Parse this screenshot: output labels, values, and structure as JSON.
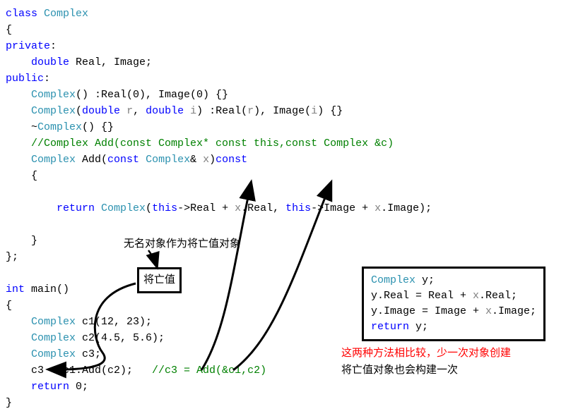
{
  "code": {
    "l1_kw": "class",
    "l1_type": " Complex",
    "l2": "{",
    "l3_kw": "private",
    "l3_colon": ":",
    "l4_kw": "double",
    "l4_rest": " Real, Image;",
    "l5_kw": "public",
    "l5_colon": ":",
    "l6_type": "Complex",
    "l6_rest": "() :Real(0), Image(0) {}",
    "l7_type": "Complex",
    "l7_a": "(",
    "l7_kw1": "double",
    "l7_b": " ",
    "l7_id1": "r",
    "l7_c": ", ",
    "l7_kw2": "double",
    "l7_d": " ",
    "l7_id2": "i",
    "l7_e": ") :Real(",
    "l7_id3": "r",
    "l7_f": "), Image(",
    "l7_id4": "i",
    "l7_g": ") {}",
    "l8_a": "~",
    "l8_type": "Complex",
    "l8_b": "() {}",
    "l9_comment": "//Complex Add(const Complex* const this,const Complex &c)",
    "l10_type": "Complex",
    "l10_a": " Add(",
    "l10_kw1": "const",
    "l10_b": " ",
    "l10_type2": "Complex",
    "l10_c": "& ",
    "l10_id": "x",
    "l10_d": ")",
    "l10_kw2": "const",
    "l11": "{",
    "l12_kw": "return",
    "l12_a": " ",
    "l12_type": "Complex",
    "l12_b": "(",
    "l12_id1": "this",
    "l12_c": "->Real + ",
    "l12_id2": "x",
    "l12_d": ".Real, ",
    "l12_id3": "this",
    "l12_e": "->Image + ",
    "l12_id4": "x",
    "l12_f": ".Image);",
    "l13": "}",
    "l14": "};",
    "main_sig_kw": "int",
    "main_sig_rest": " main()",
    "main_open": "{",
    "m1_type": "Complex",
    "m1_rest": " c1(12, 23);",
    "m2_type": "Complex",
    "m2_rest": " c2(4.5, 5.6);",
    "m3_type": "Complex",
    "m3_rest": " c3;",
    "m4_a": "c3 = c1.Add(c2);",
    "m4_comment": "//c3 = Add(&c1,c2)",
    "m5_kw": "return",
    "m5_rest": " 0;",
    "main_close": "}"
  },
  "annotations": {
    "anon_obj_note": "无名对象作为将亡值对象",
    "xvalue_box": "将亡值"
  },
  "codebox": {
    "b1_type": "Complex",
    "b1_rest": " y;",
    "b2_a": "y.Real = Real + ",
    "b2_id": "x",
    "b2_b": ".Real;",
    "b3_a": "y.Image = Image + ",
    "b3_id": "x",
    "b3_b": ".Image;",
    "b4_kw": "return",
    "b4_rest": " y;"
  },
  "notes": {
    "red": "这两种方法相比较，少一次对象创建",
    "black": "将亡值对象也会构建一次"
  }
}
